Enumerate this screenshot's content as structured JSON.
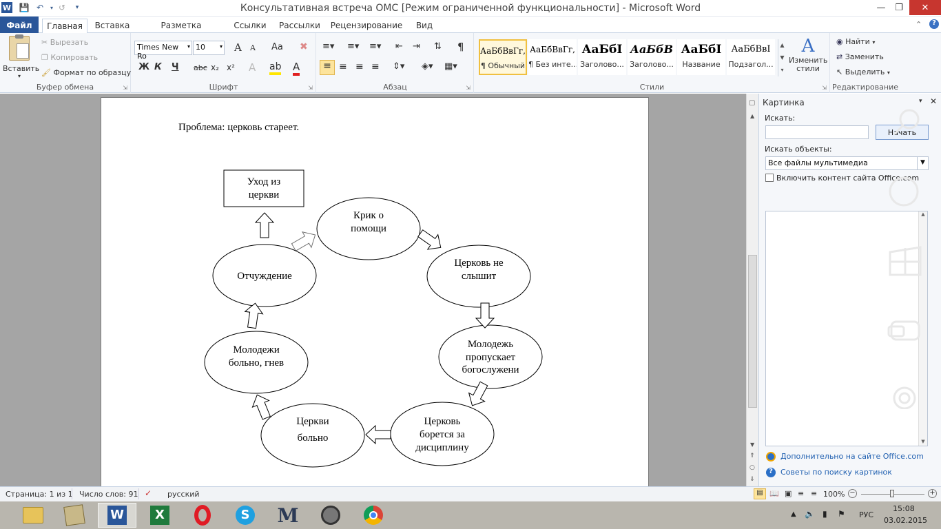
{
  "window": {
    "title": "Консультативная встреча ОМС [Режим ограниченной функциональности]  -  Microsoft Word"
  },
  "tabs": [
    "Файл",
    "Главная",
    "Вставка",
    "Разметка страницы",
    "Ссылки",
    "Рассылки",
    "Рецензирование",
    "Вид"
  ],
  "ribbon": {
    "clipboard": {
      "paste": "Вставить",
      "cut": "Вырезать",
      "copy": "Копировать",
      "format_painter": "Формат по образцу",
      "label": "Буфер обмена"
    },
    "font": {
      "name": "Times New Ro",
      "size": "10",
      "bold": "Ж",
      "italic": "К",
      "underline": "Ч",
      "strike": "abc",
      "subscript": "x₂",
      "superscript": "x²",
      "grow": "A",
      "shrink": "A",
      "case": "Aa",
      "label": "Шрифт"
    },
    "paragraph": {
      "label": "Абзац"
    },
    "styles": {
      "items": [
        {
          "sample": "АаБбВвГг,",
          "name": "¶ Обычный"
        },
        {
          "sample": "АаБбВвГг,",
          "name": "¶ Без инте..."
        },
        {
          "sample": "АаБбІ",
          "name": "Заголово..."
        },
        {
          "sample": "АаБбВ",
          "name": "Заголово..."
        },
        {
          "sample": "АаБбІ",
          "name": "Название"
        },
        {
          "sample": "АаБбВвІ",
          "name": "Подзагол..."
        }
      ],
      "change_styles": "Изменить стили",
      "label": "Стили"
    },
    "editing": {
      "find": "Найти",
      "replace": "Заменить",
      "select": "Выделить",
      "label": "Редактирование"
    }
  },
  "document": {
    "problem": "Проблема: церковь стареет.",
    "diagram": {
      "box": [
        "Уход из",
        "церкви"
      ],
      "nodes": [
        {
          "lines": [
            "Крик о",
            "помощи"
          ]
        },
        {
          "lines": [
            "Церковь не",
            "слышит"
          ]
        },
        {
          "lines": [
            "Молодежь",
            "пропускает",
            "богослужени"
          ]
        },
        {
          "lines": [
            "Церковь",
            "борется за",
            "дисциплину"
          ]
        },
        {
          "lines": [
            "Церкви",
            "больно"
          ]
        },
        {
          "lines": [
            "Молодежи",
            "больно, гнев"
          ]
        },
        {
          "lines": [
            "Отчуждение"
          ]
        }
      ]
    }
  },
  "clipart_pane": {
    "title": "Картинка",
    "search_label": "Искать:",
    "search_value": "",
    "go_button": "Начать",
    "objects_label": "Искать объекты:",
    "objects_value": "Все файлы мультимедиа",
    "include_office": "Включить контент сайта Office.com",
    "link_more": "Дополнительно на сайте Office.com",
    "link_tips": "Советы по поиску картинок"
  },
  "status": {
    "page": "Страница: 1 из 1",
    "words": "Число слов: 91",
    "language": "русский",
    "zoom": "100%"
  },
  "taskbar": {
    "language": "РУС",
    "time": "15:08",
    "date": "03.02.2015"
  },
  "colors": {
    "file_tab": "#2a5699",
    "link": "#1f5fb0",
    "taskbar": "#b9b6ae"
  }
}
